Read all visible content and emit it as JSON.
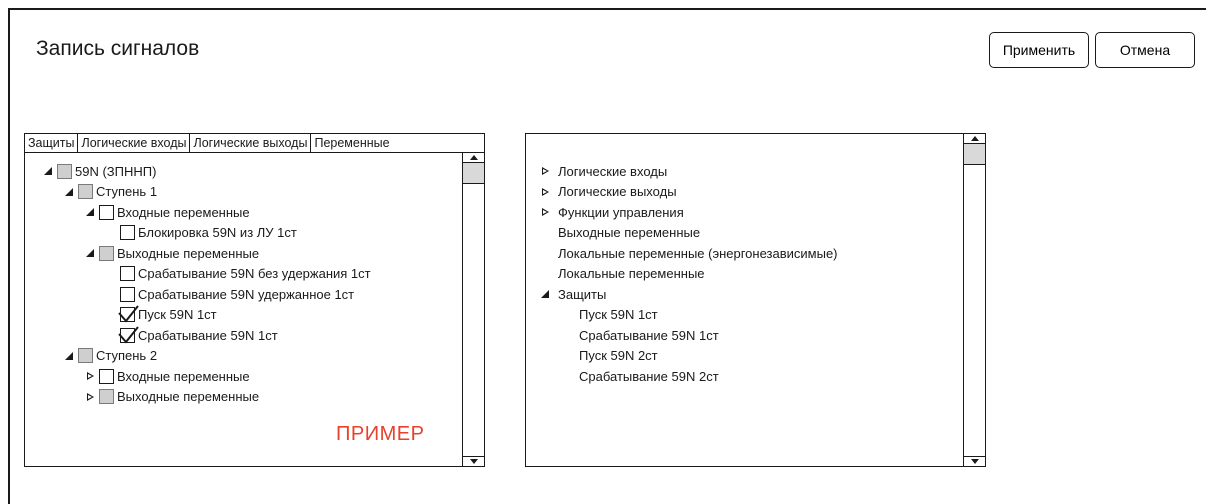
{
  "window": {
    "title": "Запись сигналов",
    "apply_label": "Применить",
    "cancel_label": "Отмена"
  },
  "left_panel": {
    "tabs": [
      {
        "label": "Защиты",
        "active": true
      },
      {
        "label": "Логические входы",
        "active": false
      },
      {
        "label": "Логические выходы",
        "active": false
      },
      {
        "label": "Переменные",
        "active": false
      }
    ],
    "tree": [
      {
        "label": "59N (ЗПННП)",
        "level": 0,
        "expander": "expanded",
        "checkbox": "partial"
      },
      {
        "label": "Ступень 1",
        "level": 1,
        "expander": "expanded",
        "checkbox": "partial"
      },
      {
        "label": "Входные переменные",
        "level": 2,
        "expander": "expanded",
        "checkbox": "unchecked"
      },
      {
        "label": "Блокировка 59N из ЛУ 1ст",
        "level": 3,
        "expander": "none",
        "checkbox": "unchecked"
      },
      {
        "label": "Выходные переменные",
        "level": 2,
        "expander": "expanded",
        "checkbox": "partial"
      },
      {
        "label": "Срабатывание 59N без удержания 1ст",
        "level": 3,
        "expander": "none",
        "checkbox": "unchecked"
      },
      {
        "label": "Срабатывание 59N удержанное 1ст",
        "level": 3,
        "expander": "none",
        "checkbox": "unchecked"
      },
      {
        "label": "Пуск 59N 1ст",
        "level": 3,
        "expander": "none",
        "checkbox": "checked"
      },
      {
        "label": "Срабатывание 59N 1ст",
        "level": 3,
        "expander": "none",
        "checkbox": "checked"
      },
      {
        "label": "Ступень 2",
        "level": 1,
        "expander": "expanded",
        "checkbox": "partial"
      },
      {
        "label": "Входные переменные",
        "level": 2,
        "expander": "collapsed",
        "checkbox": "unchecked"
      },
      {
        "label": "Выходные переменные",
        "level": 2,
        "expander": "collapsed",
        "checkbox": "partial"
      }
    ],
    "stamp": "ПРИМЕР",
    "stamp_color": "#e8412c"
  },
  "right_panel": {
    "tree": [
      {
        "label": "Логические входы",
        "level": 0,
        "expander": "collapsed"
      },
      {
        "label": "Логические выходы",
        "level": 0,
        "expander": "collapsed"
      },
      {
        "label": "Функции управления",
        "level": 0,
        "expander": "collapsed"
      },
      {
        "label": "Выходные переменные",
        "level": 0,
        "expander": "none"
      },
      {
        "label": "Локальные переменные (энергонезависимые)",
        "level": 0,
        "expander": "none"
      },
      {
        "label": "Локальные переменные",
        "level": 0,
        "expander": "none"
      },
      {
        "label": "Защиты",
        "level": 0,
        "expander": "expanded"
      },
      {
        "label": "Пуск 59N 1ст",
        "level": 1,
        "expander": "none"
      },
      {
        "label": "Срабатывание 59N 1ст",
        "level": 1,
        "expander": "none"
      },
      {
        "label": "Пуск 59N 2ст",
        "level": 1,
        "expander": "none"
      },
      {
        "label": "Срабатывание 59N 2ст",
        "level": 1,
        "expander": "none"
      }
    ]
  }
}
